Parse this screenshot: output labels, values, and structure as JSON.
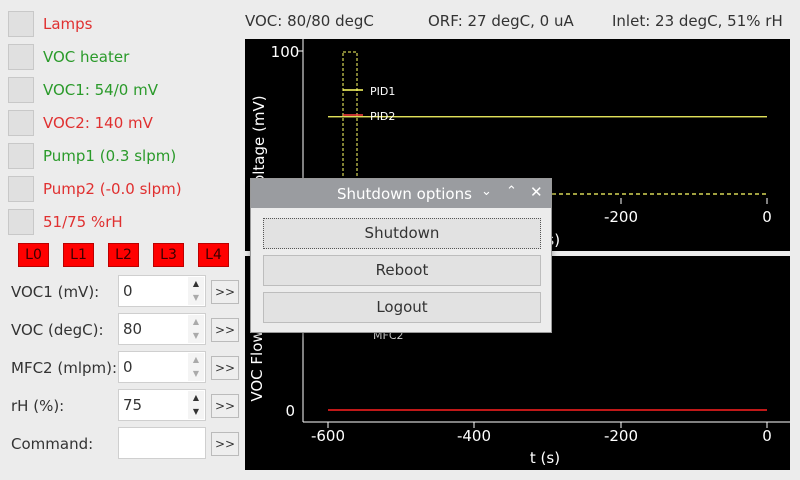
{
  "status_items": [
    {
      "label": "Lamps",
      "color": "#e03030"
    },
    {
      "label": "VOC heater",
      "color": "#2a9a2a"
    },
    {
      "label": "VOC1: 54/0 mV",
      "color": "#2a9a2a"
    },
    {
      "label": "VOC2: 140 mV",
      "color": "#e03030"
    },
    {
      "label": "Pump1 (0.3 slpm)",
      "color": "#2a9a2a"
    },
    {
      "label": "Pump2 (-0.0 slpm)",
      "color": "#e03030"
    },
    {
      "label": "51/75 %rH",
      "color": "#e03030"
    }
  ],
  "l_buttons": [
    "L0",
    "L1",
    "L2",
    "L3",
    "L4"
  ],
  "controls": {
    "voc1": {
      "label": "VOC1 (mV):",
      "value": "0"
    },
    "voc": {
      "label": "VOC (degC):",
      "value": "80"
    },
    "mfc2": {
      "label": "MFC2 (mlpm):",
      "value": "0"
    },
    "rh": {
      "label": "rH (%):",
      "value": "75"
    },
    "command": {
      "label": "Command:",
      "value": ""
    },
    "go_label": ">>"
  },
  "header": {
    "voc": "VOC: 80/80 degC",
    "orf": "ORF: 27 degC, 0 uA",
    "inlet": "Inlet: 23 degC, 51% rH"
  },
  "dialog": {
    "title": "Shutdown options",
    "buttons": [
      "Shutdown",
      "Reboot",
      "Logout"
    ]
  },
  "chart_data": [
    {
      "type": "line",
      "ylabel": "PID voltage (mV)",
      "xlabel": "t (s)",
      "yticks": [
        "100"
      ],
      "xticks": [
        "-200",
        "0"
      ],
      "xlim": [
        -630,
        20
      ],
      "ylim": [
        0,
        100
      ],
      "series": [
        {
          "name": "PID1",
          "color": "#ffff66",
          "x": [
            -600,
            0
          ],
          "y": [
            0,
            0
          ]
        },
        {
          "name": "PID2",
          "color": "#ffff66",
          "x": [
            -600,
            0
          ],
          "y": [
            54,
            54
          ]
        }
      ]
    },
    {
      "type": "line",
      "ylabel": "VOC Flow",
      "xlabel": "t (s)",
      "yticks": [
        "0"
      ],
      "xticks": [
        "-600",
        "-400",
        "-200",
        "0"
      ],
      "legend_visible": [
        "MFC2"
      ],
      "xlim": [
        -630,
        20
      ],
      "series": [
        {
          "name": "MFC2",
          "color": "#ff2020",
          "x": [
            -600,
            0
          ],
          "y": [
            0,
            0
          ]
        }
      ]
    }
  ]
}
